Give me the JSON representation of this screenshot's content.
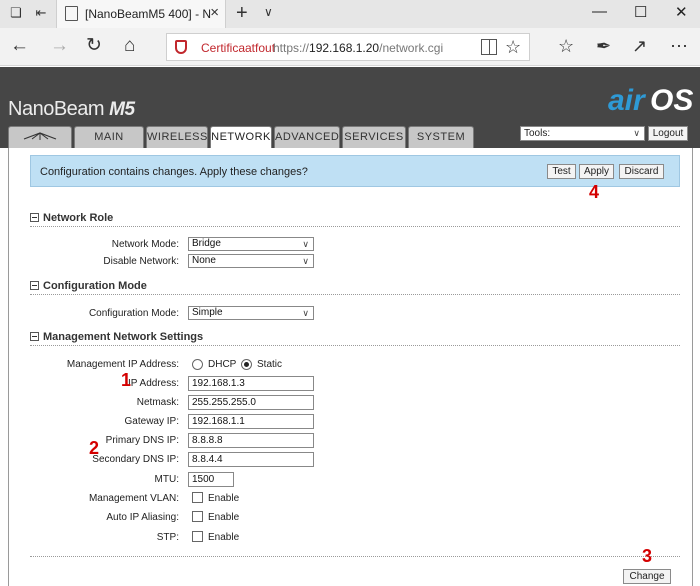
{
  "browser": {
    "tab_title": "[NanoBeamM5 400] - N",
    "cert_warning": "Certificaatfout",
    "url_protocol": "https://",
    "url_host": "192.168.1.20",
    "url_path": "/network.cgi"
  },
  "device": {
    "brand": "NanoBeam",
    "model": "M5",
    "logo_air": "air",
    "logo_os": "OS"
  },
  "nav": {
    "tabs": [
      "MAIN",
      "WIRELESS",
      "NETWORK",
      "ADVANCED",
      "SERVICES",
      "SYSTEM"
    ],
    "active": "NETWORK",
    "tools_value": "Tools:",
    "logout_label": "Logout"
  },
  "notice": {
    "text": "Configuration contains changes. Apply these changes?",
    "test_label": "Test",
    "apply_label": "Apply",
    "discard_label": "Discard"
  },
  "network_role": {
    "title": "Network Role",
    "network_mode_label": "Network Mode:",
    "network_mode_value": "Bridge",
    "disable_network_label": "Disable Network:",
    "disable_network_value": "None"
  },
  "configuration_mode": {
    "title": "Configuration Mode",
    "mode_label": "Configuration Mode:",
    "mode_value": "Simple"
  },
  "management": {
    "title": "Management Network Settings",
    "ip_address_mode_label": "Management IP Address:",
    "dhcp_label": "DHCP",
    "static_label": "Static",
    "selected_mode": "Static",
    "ip_label": "IP Address:",
    "ip_value": "192.168.1.3",
    "netmask_label": "Netmask:",
    "netmask_value": "255.255.255.0",
    "gateway_label": "Gateway IP:",
    "gateway_value": "192.168.1.1",
    "primary_dns_label": "Primary DNS IP:",
    "primary_dns_value": "8.8.8.8",
    "secondary_dns_label": "Secondary DNS IP:",
    "secondary_dns_value": "8.8.4.4",
    "mtu_label": "MTU:",
    "mtu_value": "1500",
    "vlan_label": "Management VLAN:",
    "vlan_enable_label": "Enable",
    "alias_label": "Auto IP Aliasing:",
    "alias_enable_label": "Enable",
    "stp_label": "STP:",
    "stp_enable_label": "Enable",
    "change_label": "Change"
  },
  "annotations": {
    "marker_1": "1",
    "marker_2": "2",
    "marker_3": "3",
    "marker_4": "4"
  },
  "colors": {
    "header_bg": "#464646",
    "notice_bg": "#bfe0f4",
    "logo_air": "#2e9ad6",
    "cert_warning": "#c1272d",
    "annotation": "#d40000"
  }
}
